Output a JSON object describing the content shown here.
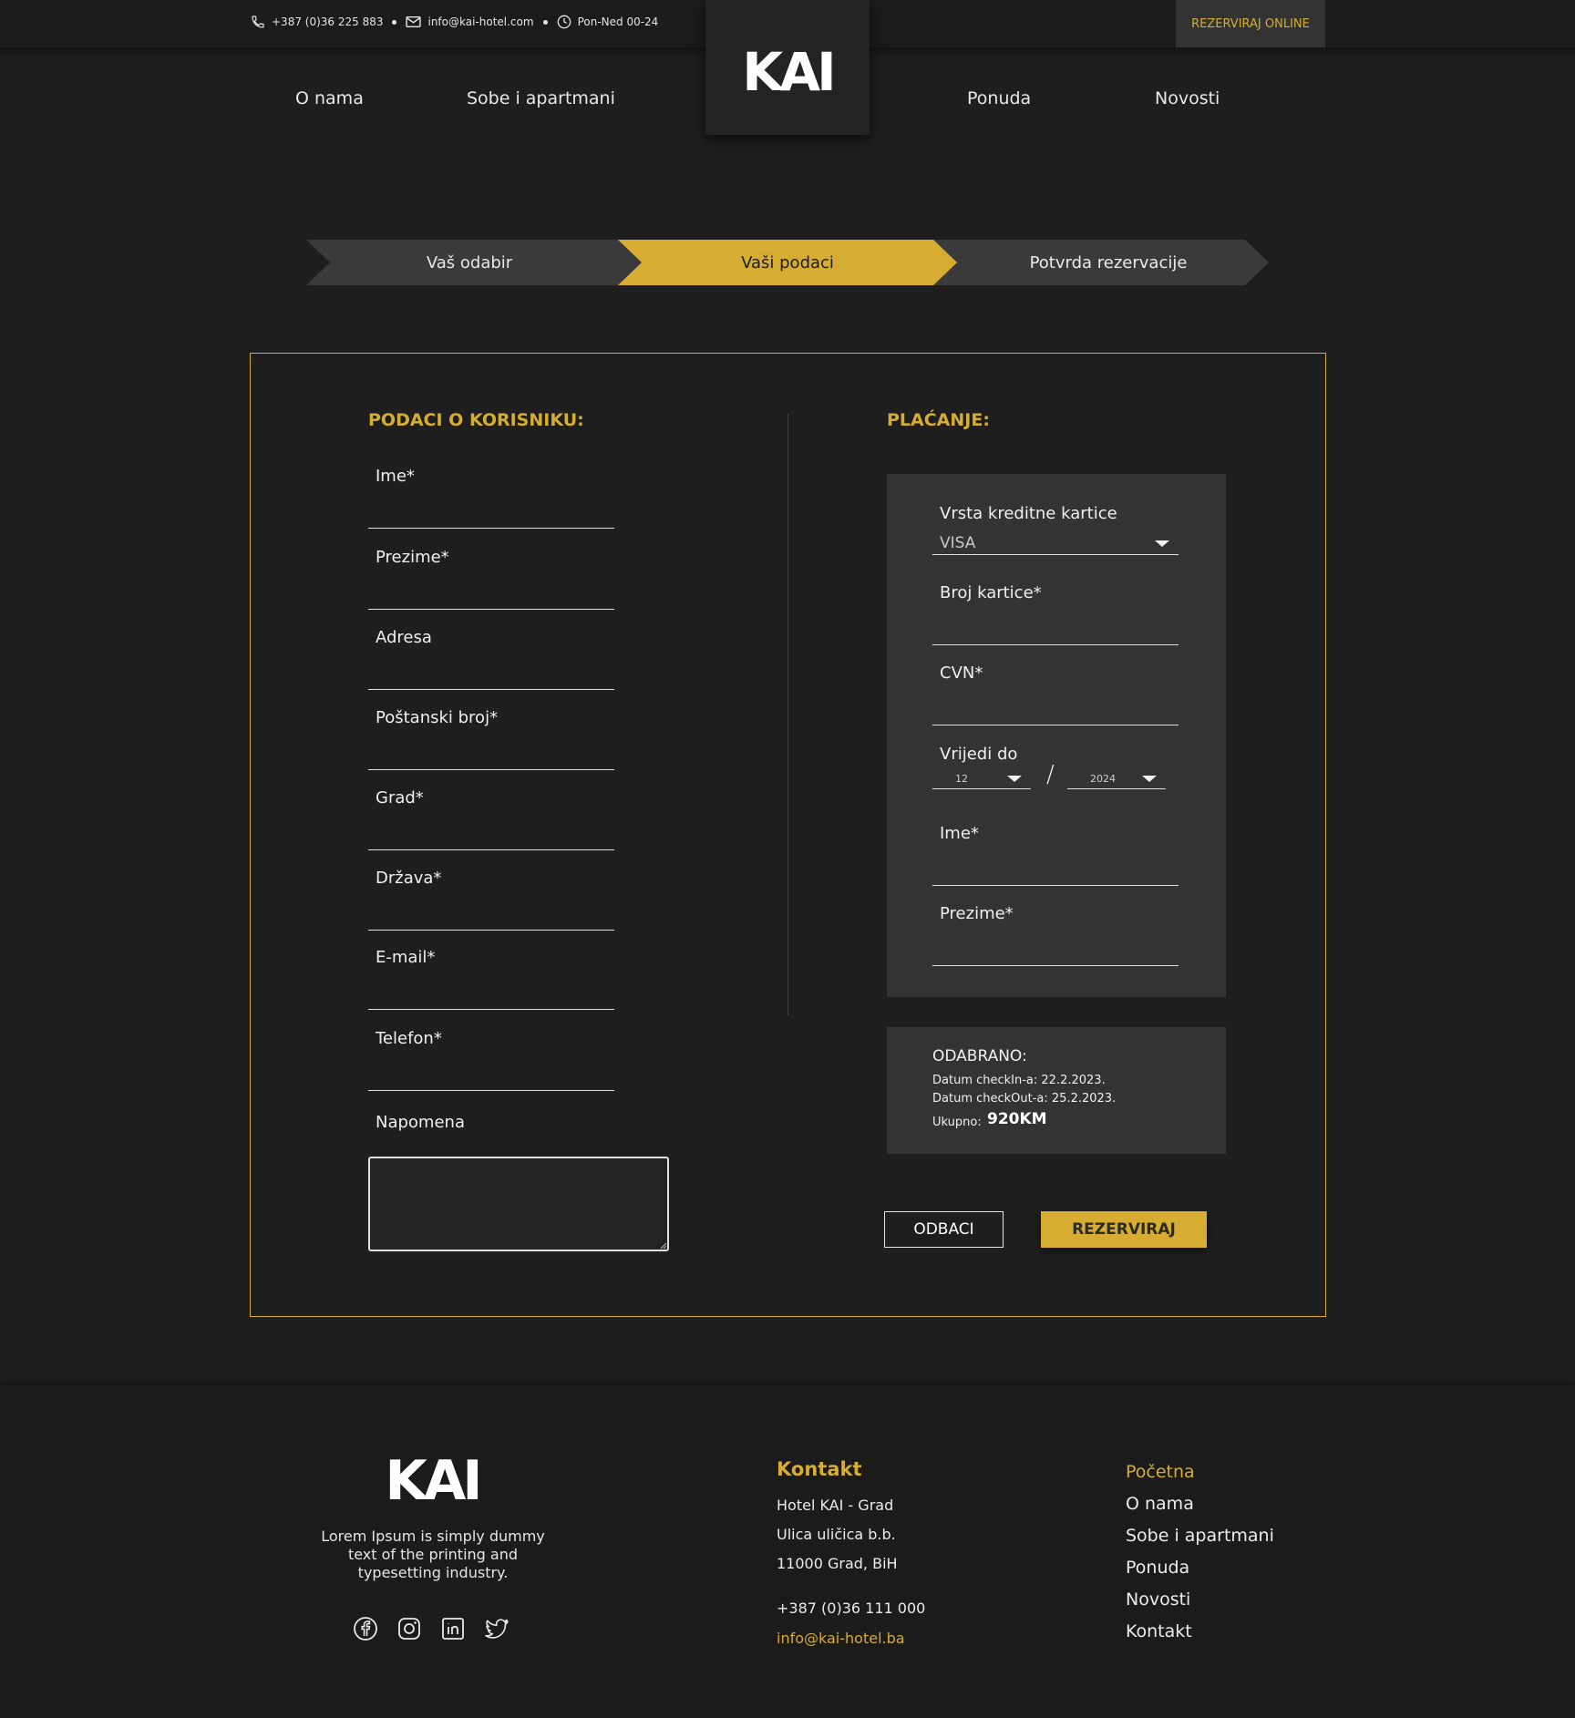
{
  "topbar": {
    "phone": "+387 (0)36 225 883",
    "email": "info@kai-hotel.com",
    "hours": "Pon-Ned 00-24",
    "book_online": "REZERVIRAJ ONLINE"
  },
  "nav": {
    "logo": "KAI",
    "items": [
      "O nama",
      "Sobe i apartmani",
      "Ponuda",
      "Novosti"
    ]
  },
  "steps": [
    "Vaš odabir",
    "Vaši podaci",
    "Potvrda rezervacije"
  ],
  "user_form": {
    "title": "PODACI O KORISNIKU:",
    "fields": [
      "Ime*",
      "Prezime*",
      "Adresa",
      "Poštanski broj*",
      "Grad*",
      "Država*",
      "E-mail*",
      "Telefon*"
    ],
    "note_label": "Napomena"
  },
  "payment": {
    "title": "PLAĆANJE:",
    "card_type_label": "Vrsta kreditne kartice",
    "card_type_value": "VISA",
    "card_number_label": "Broj kartice*",
    "cvn_label": "CVN*",
    "valid_until_label": "Vrijedi do",
    "month": "12",
    "separator": "/",
    "year": "2024",
    "first_name_label": "Ime*",
    "last_name_label": "Prezime*"
  },
  "summary": {
    "title": "ODABRANO:",
    "checkin": "Datum checkIn-a: 22.2.2023.",
    "checkout": "Datum checkOut-a: 25.2.2023.",
    "total_label": "Ukupno:",
    "total_value": "920KM"
  },
  "buttons": {
    "cancel": "ODBACI",
    "submit": "REZERVIRAJ"
  },
  "footer": {
    "logo": "KAI",
    "description": "Lorem Ipsum is simply dummy text of the printing and typesetting industry.",
    "social_icons": [
      "facebook-icon",
      "instagram-icon",
      "linkedin-icon",
      "twitter-icon"
    ],
    "contact_title": "Kontakt",
    "contact_lines": [
      "Hotel KAI - Grad",
      "Ulica uličica b.b.",
      "11000 Grad, BiH",
      "+387 (0)36 111 000",
      "info@kai-hotel.ba"
    ],
    "menu": [
      "Početna",
      "O nama",
      "Sobe i apartmani",
      "Ponuda",
      "Novosti",
      "Kontakt"
    ],
    "menu_active": "Početna"
  },
  "colors": {
    "accent": "#d6ad32",
    "background": "#1e1e1e",
    "panel": "#333333"
  }
}
